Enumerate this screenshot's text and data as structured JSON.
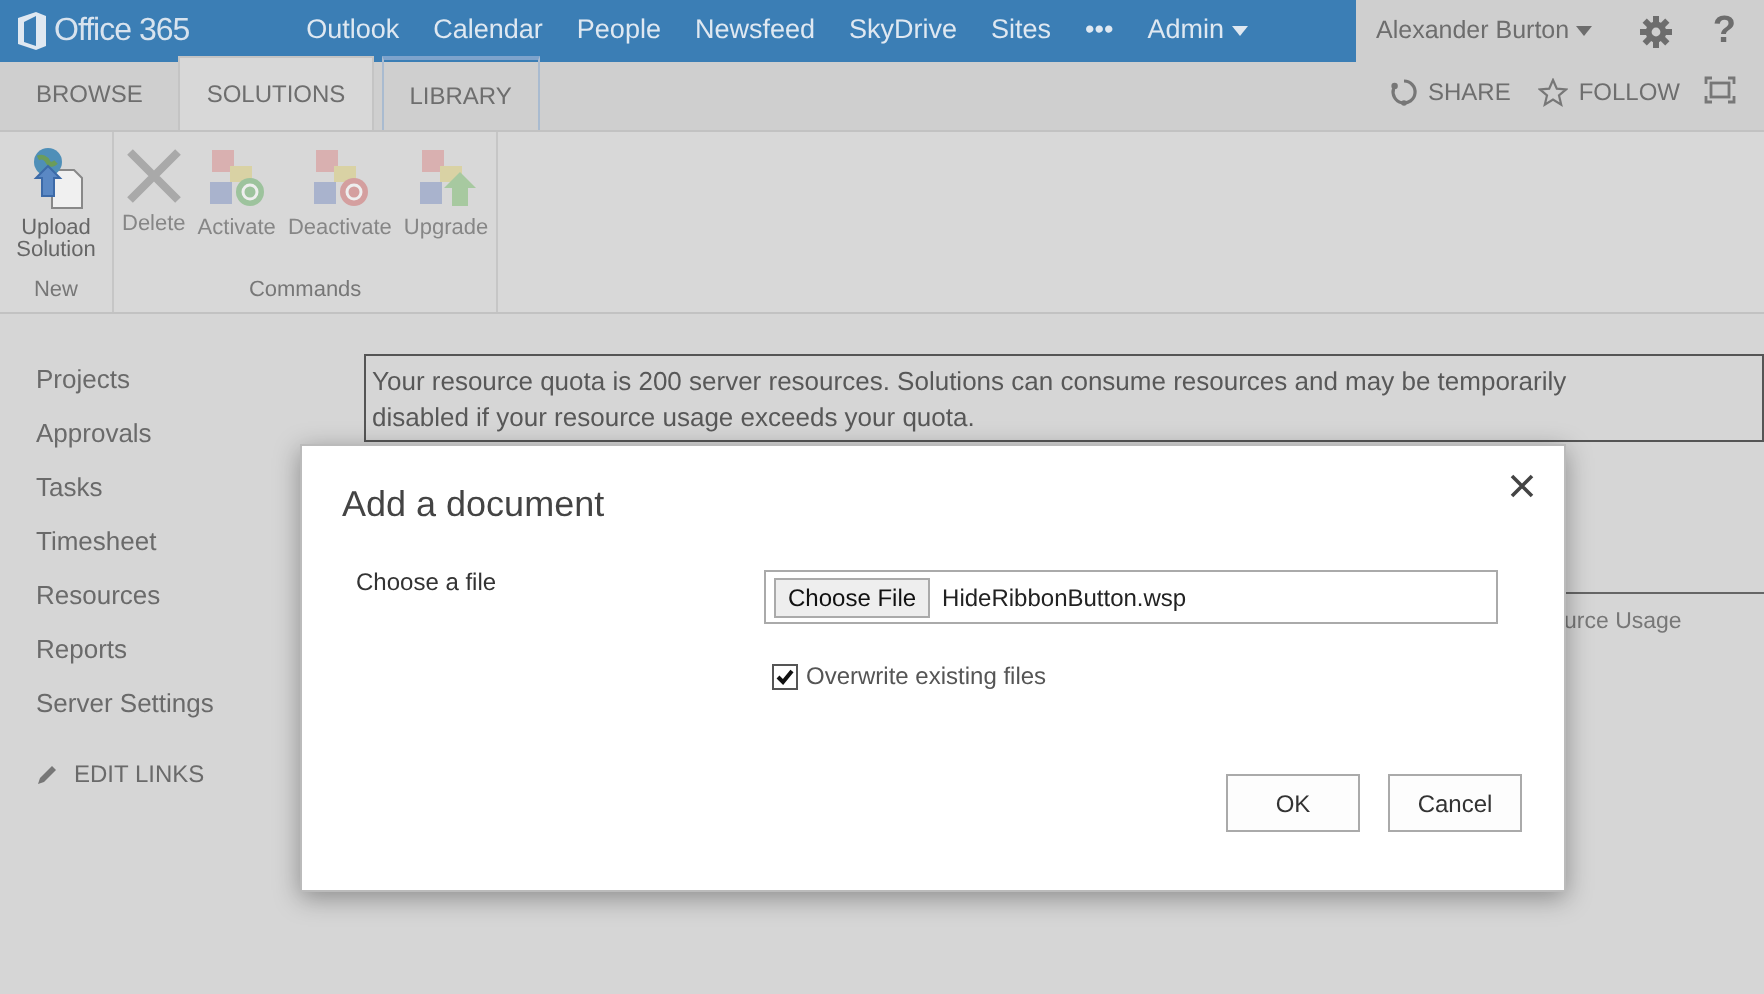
{
  "top_bar": {
    "brand": "Office 365",
    "links": [
      {
        "label": "Outlook",
        "dropdown": false
      },
      {
        "label": "Calendar",
        "dropdown": false
      },
      {
        "label": "People",
        "dropdown": false
      },
      {
        "label": "Newsfeed",
        "dropdown": false
      },
      {
        "label": "SkyDrive",
        "dropdown": false
      },
      {
        "label": "Sites",
        "dropdown": false
      },
      {
        "label": "•••",
        "dropdown": false
      },
      {
        "label": "Admin",
        "dropdown": true
      }
    ],
    "user": {
      "name": "Alexander Burton",
      "dropdown": true
    },
    "help": "?"
  },
  "ribbon_tabs": [
    {
      "label": "BROWSE",
      "selected": false,
      "kind": "standard"
    },
    {
      "label": "SOLUTIONS",
      "selected": true,
      "kind": "standard"
    },
    {
      "label": "LIBRARY",
      "selected": false,
      "kind": "contextual"
    }
  ],
  "page_actions": [
    {
      "label": "SHARE",
      "kind": "share"
    },
    {
      "label": "FOLLOW",
      "kind": "follow"
    }
  ],
  "ribbon_groups": [
    {
      "label": "New",
      "buttons": [
        {
          "label": "Upload Solution",
          "kind": "upload",
          "disabled": false
        }
      ]
    },
    {
      "label": "Commands",
      "buttons": [
        {
          "label": "Delete",
          "kind": "delete",
          "disabled": true
        },
        {
          "label": "Activate",
          "kind": "activate",
          "disabled": true
        },
        {
          "label": "Deactivate",
          "kind": "deactivate",
          "disabled": true
        },
        {
          "label": "Upgrade",
          "kind": "upgrade",
          "disabled": true
        }
      ]
    }
  ],
  "sidebar": {
    "items": [
      {
        "label": "Projects"
      },
      {
        "label": "Approvals"
      },
      {
        "label": "Tasks"
      },
      {
        "label": "Timesheet"
      },
      {
        "label": "Resources"
      },
      {
        "label": "Reports"
      },
      {
        "label": "Server Settings"
      }
    ],
    "edit_links": "EDIT LINKS"
  },
  "quota_notice": {
    "text": "Your resource quota is 200 server resources. Solutions can consume resources and may be temporarily disabled if your resource usage exceeds your quota."
  },
  "table": {
    "column_header": "urce Usage"
  },
  "dialog": {
    "title": "Add a document",
    "file_label": "Choose a file",
    "file_button": "Choose File",
    "file_name": "HideRibbonButton.wsp",
    "overwrite": {
      "label": "Overwrite existing files",
      "checked": true
    },
    "buttons": [
      {
        "label": "OK"
      },
      {
        "label": "Cancel"
      }
    ]
  }
}
